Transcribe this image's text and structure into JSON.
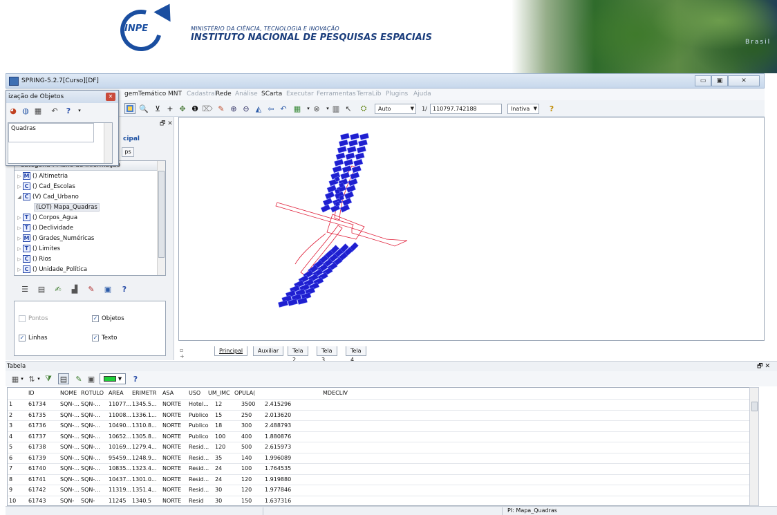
{
  "banner": {
    "logo_word": "INPE",
    "ministry": "MINISTÉRIO DA CIÊNCIA, TECNOLOGIA E INOVAÇÃO",
    "institute": "INSTITUTO NACIONAL DE PESQUISAS ESPACIAIS",
    "brasil": "Brasil"
  },
  "window": {
    "title": "SPRING-5.2.7[Curso][DF]",
    "controls": {
      "minimize": "▭",
      "maximize": "▣",
      "close": "✕"
    }
  },
  "menubar": {
    "items": [
      {
        "label": "gem",
        "enabled": true
      },
      {
        "label": "Temático",
        "enabled": true
      },
      {
        "label": "MNT",
        "enabled": true
      },
      {
        "label": "Cadastral",
        "enabled": false
      },
      {
        "label": "Rede",
        "enabled": true
      },
      {
        "label": "Análise",
        "enabled": false
      },
      {
        "label": "SCarta",
        "enabled": true
      },
      {
        "label": "Executar",
        "enabled": false
      },
      {
        "label": "Ferramentas",
        "enabled": false
      },
      {
        "label": "TerraLib",
        "enabled": false
      },
      {
        "label": "Plugins",
        "enabled": false
      },
      {
        "label": "Ajuda",
        "enabled": false
      }
    ]
  },
  "toolbar": {
    "zoom_mode": "Auto",
    "scale_prefix": "1/",
    "scale_value": "110797.742188",
    "state": "Inativa",
    "help": "?"
  },
  "obj_dialog": {
    "title": "ização de Objetos",
    "close": "✕",
    "item": "Quadras"
  },
  "left_panel": {
    "dock_ctrl": "🗗 ✕",
    "principal": "cipal",
    "tab_ps": "ps",
    "tree_header": "Categoria : Plano de Informação",
    "tree": [
      {
        "exp": "▷",
        "cat": "M",
        "label": "() Altimetria"
      },
      {
        "exp": "▷",
        "cat": "C",
        "label": "() Cad_Escolas"
      },
      {
        "exp": "◢",
        "cat": "C",
        "label": "(V) Cad_Urbano"
      },
      {
        "exp": "",
        "cat": "",
        "label": "(LOT) Mapa_Quadras",
        "selected": true
      },
      {
        "exp": "▷",
        "cat": "T",
        "label": "() Corpos_Agua"
      },
      {
        "exp": "▷",
        "cat": "T",
        "label": "() Declividade"
      },
      {
        "exp": "▷",
        "cat": "M",
        "label": "() Grades_Numéricas"
      },
      {
        "exp": "▷",
        "cat": "T",
        "label": "() Limites"
      },
      {
        "exp": "▷",
        "cat": "C",
        "label": "() Rios"
      },
      {
        "exp": "▷",
        "cat": "C",
        "label": "() Unidade_Política"
      }
    ],
    "visibility": {
      "pontos": "Pontos",
      "objetos": "Objetos",
      "linhas": "Linhas",
      "texto": "Texto"
    }
  },
  "map_tabs": {
    "ctrls": "▫ + − »",
    "tabs": [
      "Principal",
      "Auxiliar",
      "Tela 2",
      "Tela 3",
      "Tela 4"
    ]
  },
  "tabela": {
    "title": "Tabela",
    "ctrl": "🗗 ✕",
    "columns": [
      "ID",
      "NOME",
      "ROTULO",
      "AREA",
      "ERIMETR",
      "ASA",
      "USO",
      "UM_IMC",
      "OPULA(",
      "",
      "MDECLIV"
    ],
    "rows": [
      [
        "1",
        "61734",
        "SQN-...",
        "SQN-...",
        "11077...",
        "1345.5...",
        "NORTE",
        "Hotel...",
        "12",
        "3500",
        "2.415296"
      ],
      [
        "2",
        "61735",
        "SQN-...",
        "SQN-...",
        "11008...",
        "1336.1...",
        "NORTE",
        "Publico",
        "15",
        "250",
        "2.013620"
      ],
      [
        "3",
        "61736",
        "SQN-...",
        "SQN-...",
        "10490...",
        "1310.8...",
        "NORTE",
        "Publico",
        "18",
        "300",
        "2.488793"
      ],
      [
        "4",
        "61737",
        "SQN-...",
        "SQN-...",
        "10652...",
        "1305.8...",
        "NORTE",
        "Publico",
        "100",
        "400",
        "1.880876"
      ],
      [
        "5",
        "61738",
        "SQN-...",
        "SQN-...",
        "10169...",
        "1279.4...",
        "NORTE",
        "Resid...",
        "120",
        "500",
        "2.615973"
      ],
      [
        "6",
        "61739",
        "SQN-...",
        "SQN-...",
        "95459...",
        "1248.9...",
        "NORTE",
        "Resid...",
        "35",
        "140",
        "1.996089"
      ],
      [
        "7",
        "61740",
        "SQN-...",
        "SQN-...",
        "10835...",
        "1323.4...",
        "NORTE",
        "Resid...",
        "24",
        "100",
        "1.764535"
      ],
      [
        "8",
        "61741",
        "SQN-...",
        "SQN-...",
        "10437...",
        "1301.0...",
        "NORTE",
        "Resid...",
        "24",
        "120",
        "1.919880"
      ],
      [
        "9",
        "61742",
        "SQN-...",
        "SQN-...",
        "11319...",
        "1351.4...",
        "NORTE",
        "Resid...",
        "30",
        "120",
        "1.977846"
      ],
      [
        "10",
        "61743",
        "SQN-",
        "SQN-",
        "11245",
        "1340.5",
        "NORTE",
        "Resid",
        "30",
        "150",
        "1.637316"
      ]
    ]
  },
  "status": {
    "pi": "PI: Mapa_Quadras"
  },
  "colors": {
    "map_fill": "#1f1fcf",
    "map_line": "#e0203a",
    "accent": "#1a4ea0"
  }
}
